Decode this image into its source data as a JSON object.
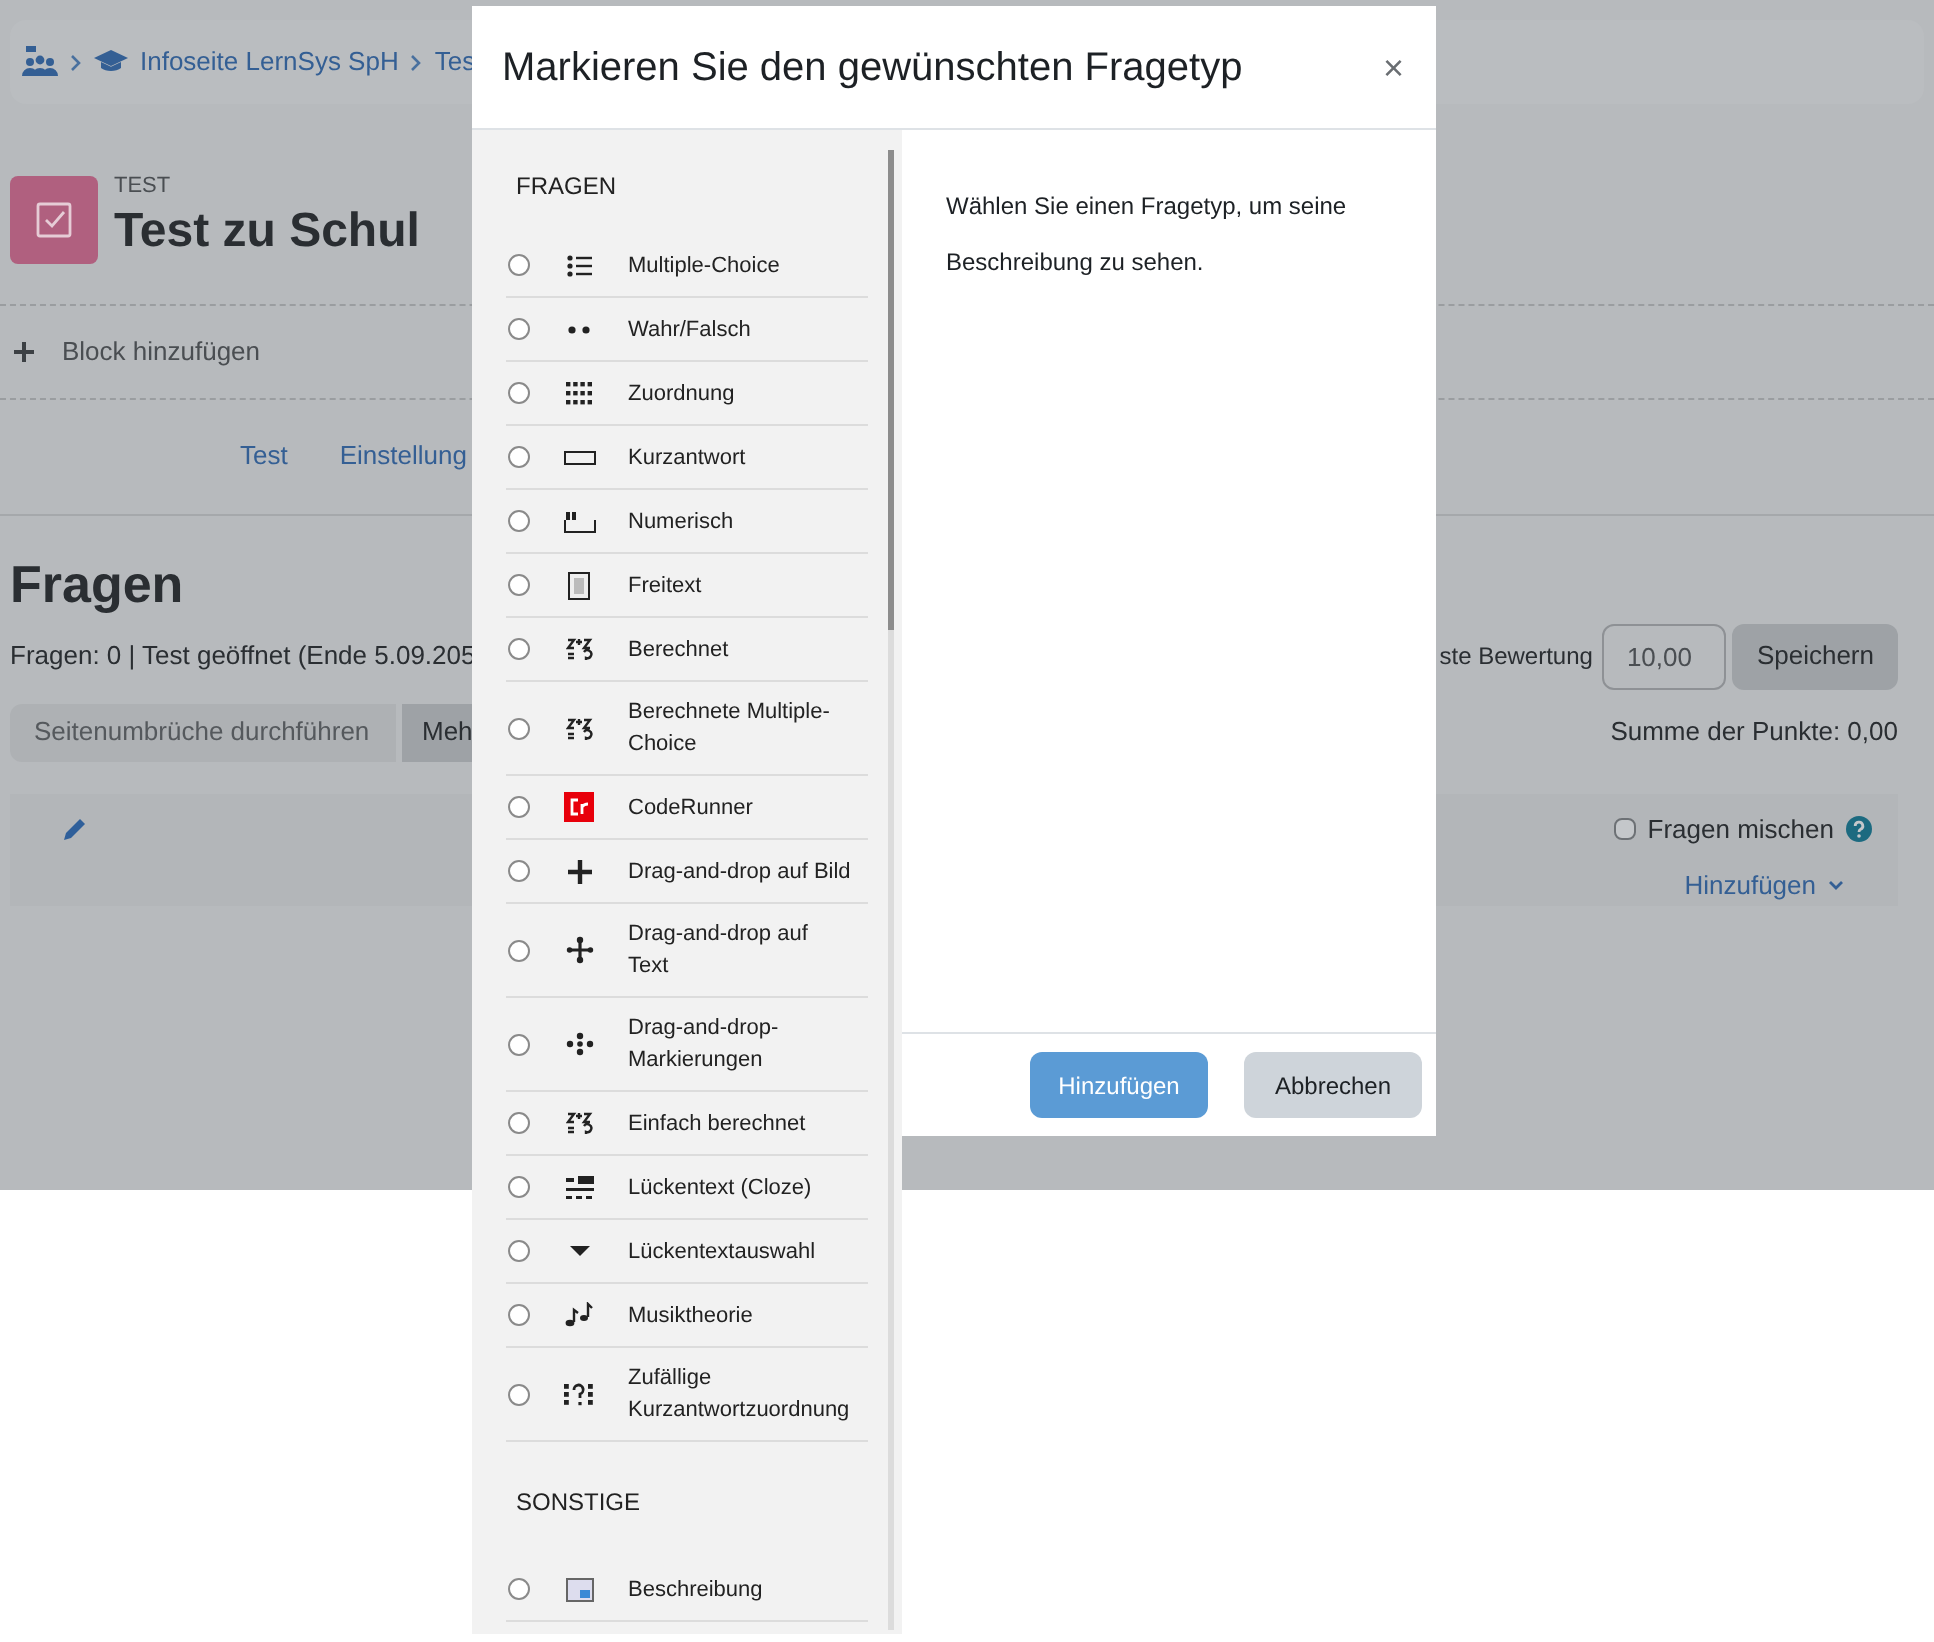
{
  "page": {
    "breadcrumb": [
      {
        "kind": "home"
      },
      {
        "kind": "course",
        "label": "Infoseite LernSys SpH"
      },
      {
        "kind": "plain",
        "label": "Tes"
      }
    ],
    "activity_type": "TEST",
    "title": "Test zu Schul",
    "add_block": "Block hinzufügen",
    "tabs": [
      {
        "label": "Test",
        "selected": false
      },
      {
        "label": "Einstellung",
        "selected": false
      }
    ],
    "heading": "Fragen",
    "status": "Fragen: 0 | Test geöffnet (Ende 5.09.205",
    "grade_label": "ste Bewertung",
    "grade_value": "10,00",
    "save_button": "Speichern",
    "buttons": [
      "Seitenumbrüche durchführen",
      "Meh"
    ],
    "total": "Summe der Punkte: 0,00",
    "shuffle": {
      "label": "Fragen mischen",
      "checked": false
    },
    "add_menu": "Hinzufügen"
  },
  "dialog": {
    "title": "Markieren Sie den gewünschten Fragetyp",
    "close": "×",
    "description": "Wählen Sie einen Fragetyp, um seine Beschreibung zu sehen.",
    "sections": [
      {
        "heading": "FRAGEN",
        "items": [
          {
            "label": "Multiple-Choice",
            "kind": "multichoice",
            "selected": false
          },
          {
            "label": "Wahr/Falsch",
            "kind": "truefalse",
            "selected": false
          },
          {
            "label": "Zuordnung",
            "kind": "match",
            "selected": false
          },
          {
            "label": "Kurzantwort",
            "kind": "shortanswer",
            "selected": false
          },
          {
            "label": "Numerisch",
            "kind": "numerical",
            "selected": false
          },
          {
            "label": "Freitext",
            "kind": "essay",
            "selected": false
          },
          {
            "label": "Berechnet",
            "kind": "calculated",
            "selected": false
          },
          {
            "label": "Berechnete Multiple-Choice",
            "kind": "calculated",
            "selected": false
          },
          {
            "label": "CodeRunner",
            "kind": "coderunner",
            "selected": false
          },
          {
            "label": "Drag-and-drop auf Bild",
            "kind": "ddimage",
            "selected": false
          },
          {
            "label": "Drag-and-drop auf Text",
            "kind": "ddtext",
            "selected": false
          },
          {
            "label": "Drag-and-drop-Markierungen",
            "kind": "ddmarker",
            "selected": false
          },
          {
            "label": "Einfach berechnet",
            "kind": "calculated",
            "selected": false
          },
          {
            "label": "Lückentext (Cloze)",
            "kind": "cloze",
            "selected": false
          },
          {
            "label": "Lückentextauswahl",
            "kind": "gapselect",
            "selected": false
          },
          {
            "label": "Musiktheorie",
            "kind": "music",
            "selected": false
          },
          {
            "label": "Zufällige Kurzantwortzuordnung",
            "kind": "randommatch",
            "selected": false
          }
        ]
      },
      {
        "heading": "SONSTIGE",
        "items": [
          {
            "label": "Beschreibung",
            "kind": "description",
            "selected": false
          }
        ]
      }
    ],
    "buttons": [
      {
        "label": "Hinzufügen",
        "kind": "primary"
      },
      {
        "label": "Abbrechen",
        "kind": "secondary"
      }
    ]
  }
}
